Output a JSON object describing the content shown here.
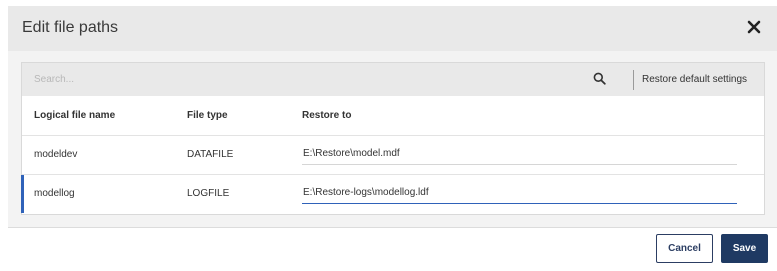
{
  "dialog": {
    "title": "Edit file paths",
    "close_icon": "close-icon"
  },
  "toolbar": {
    "search_placeholder": "Search...",
    "search_value": "",
    "search_icon": "search-icon",
    "restore_default_label": "Restore default settings"
  },
  "table": {
    "columns": [
      "Logical file name",
      "File type",
      "Restore to"
    ],
    "rows": [
      {
        "logical_name": "modeldev",
        "file_type": "DATAFILE",
        "restore_to": "E:\\Restore\\model.mdf"
      },
      {
        "logical_name": "modellog",
        "file_type": "LOGFILE",
        "restore_to": "E:\\Restore-logs\\modellog.ldf"
      }
    ],
    "selected_row": 1
  },
  "footer": {
    "cancel_label": "Cancel",
    "save_label": "Save"
  },
  "colors": {
    "header_bg": "#e9e9e9",
    "accent": "#2f62b9",
    "primary_button": "#1f3a63"
  }
}
